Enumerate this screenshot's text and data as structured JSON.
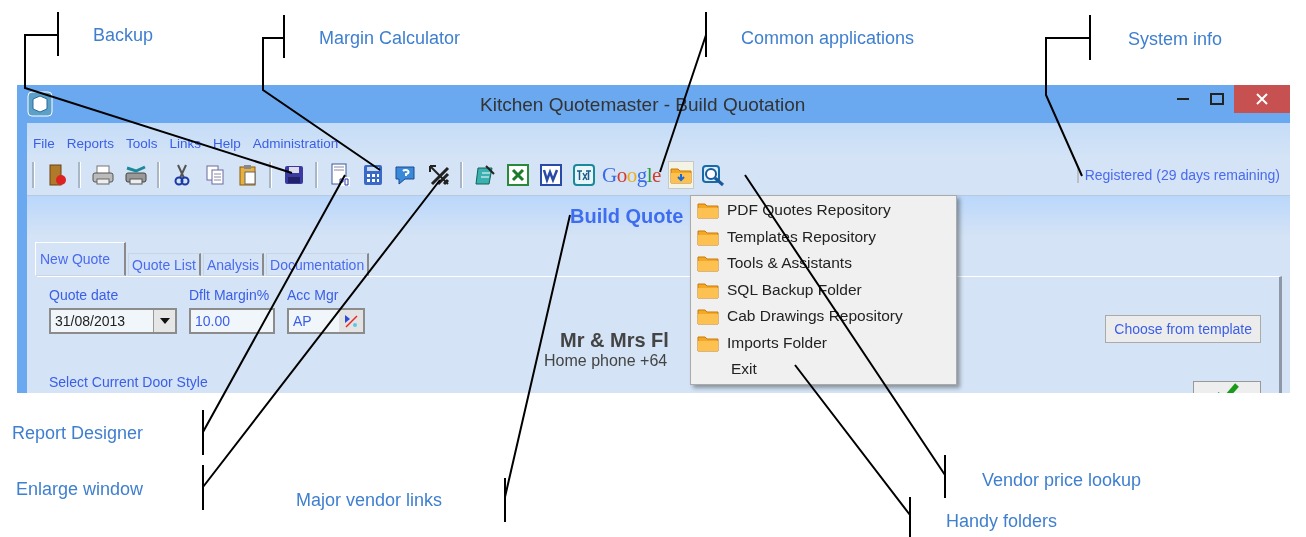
{
  "window": {
    "title": "Kitchen Quotemaster - Build Quotation"
  },
  "menu_bar": [
    "File",
    "Reports",
    "Tools",
    "Links",
    "Help",
    "Administration"
  ],
  "toolbar": {
    "google_link": "Google",
    "folders_button": {
      "pressed": true
    },
    "registration": "Registered (29 days remaining)"
  },
  "header": "Build Quote",
  "tabs": [
    {
      "label": "New Quote",
      "selected": true
    },
    {
      "label": "Quote List",
      "selected": false
    },
    {
      "label": "Analysis",
      "selected": false
    },
    {
      "label": "Documentation",
      "selected": false
    }
  ],
  "fields": {
    "quote_date": {
      "label": "Quote date",
      "value": "31/08/2013"
    },
    "margin": {
      "label": "Dflt Margin%",
      "value": "10.00"
    },
    "acc_mgr": {
      "label": "Acc Mgr",
      "value": "AP"
    }
  },
  "door_style_label": "Select Current Door Style",
  "customer": {
    "name": "Mr & Mrs Fl",
    "phone": "Home phone +64"
  },
  "template_button": "Choose from template",
  "folders_menu": [
    {
      "label": "PDF Quotes Repository",
      "kind": "folder"
    },
    {
      "label": "Templates Repository",
      "kind": "folder"
    },
    {
      "label": "Tools & Assistants",
      "kind": "folder"
    },
    {
      "label": "SQL Backup Folder",
      "kind": "folder"
    },
    {
      "label": "Cab Drawings Repository",
      "kind": "folder"
    },
    {
      "label": "Imports Folder",
      "kind": "folder"
    },
    {
      "label": "Exit",
      "kind": "plain"
    }
  ],
  "annotations": [
    {
      "label": "Backup"
    },
    {
      "label": "Margin Calculator"
    },
    {
      "label": "Common applications"
    },
    {
      "label": "System info"
    },
    {
      "label": "Report Designer"
    },
    {
      "label": "Enlarge window"
    },
    {
      "label": "Major vendor links"
    },
    {
      "label": "Vendor price lookup"
    },
    {
      "label": "Handy folders"
    }
  ]
}
